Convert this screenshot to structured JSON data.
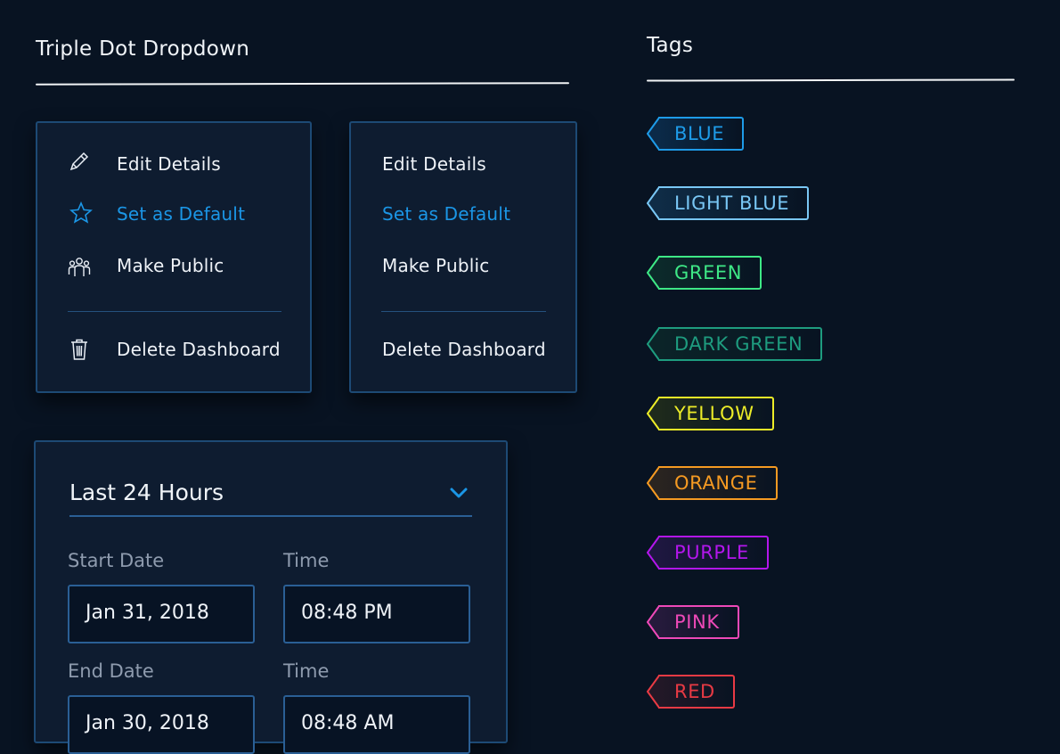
{
  "left_section": {
    "title": "Triple Dot Dropdown"
  },
  "right_section": {
    "title": "Tags"
  },
  "menu_with_icons": {
    "items": [
      {
        "label": "Edit Details",
        "icon": "pencil-icon"
      },
      {
        "label": "Set as Default",
        "icon": "star-icon"
      },
      {
        "label": "Make Public",
        "icon": "users-icon"
      },
      {
        "label": "Delete Dashboard",
        "icon": "trash-icon"
      }
    ]
  },
  "menu_plain": {
    "items": [
      {
        "label": "Edit Details"
      },
      {
        "label": "Set as Default"
      },
      {
        "label": "Make Public"
      },
      {
        "label": "Delete Dashboard"
      }
    ]
  },
  "date_picker": {
    "range_label": "Last 24 Hours",
    "start_date_label": "Start Date",
    "start_date_value": "Jan 31, 2018",
    "start_time_label": "Time",
    "start_time_value": "08:48 PM",
    "end_date_label": "End Date",
    "end_date_value": "Jan 30, 2018",
    "end_time_label": "Time",
    "end_time_value": "08:48 AM"
  },
  "tags": [
    {
      "label": "BLUE",
      "color": "#1e9be8",
      "bg": "#0b2a48"
    },
    {
      "label": "LIGHT BLUE",
      "color": "#79c7f5",
      "bg": "#0f2c46"
    },
    {
      "label": "GREEN",
      "color": "#3ee886",
      "bg": "#0c2a2a"
    },
    {
      "label": "DARK GREEN",
      "color": "#1e9c7f",
      "bg": "#0b2428"
    },
    {
      "label": "YELLOW",
      "color": "#ecec28",
      "bg": "#1e2a1c"
    },
    {
      "label": "ORANGE",
      "color": "#f59a22",
      "bg": "#2a2420"
    },
    {
      "label": "PURPLE",
      "color": "#b316ec",
      "bg": "#1e1740"
    },
    {
      "label": "PINK",
      "color": "#ee49b8",
      "bg": "#261a3c"
    },
    {
      "label": "RED",
      "color": "#e83a44",
      "bg": "#231827"
    }
  ],
  "colors": {
    "background": "#081322",
    "panel": "#0e1c30",
    "panel_border": "#1d4a75",
    "accent": "#1b96e6"
  }
}
